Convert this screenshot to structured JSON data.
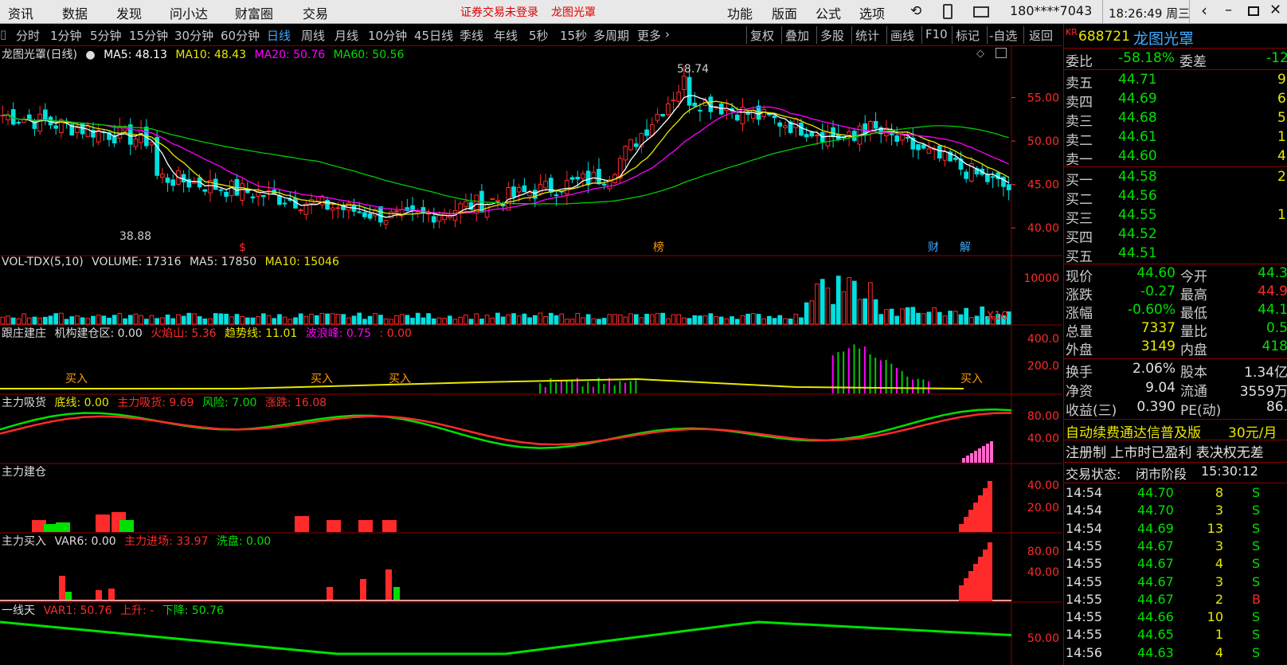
{
  "menubar": {
    "items": [
      "资讯",
      "数据",
      "发现",
      "问小达",
      "财富圈",
      "交易"
    ],
    "alert": "证券交易未登录",
    "stock_name": "龙图光罩",
    "right_items": [
      "功能",
      "版面",
      "公式",
      "选项"
    ],
    "account": "180****7043",
    "clock": "18:26:49 周三"
  },
  "periods": [
    "分时",
    "1分钟",
    "5分钟",
    "15分钟",
    "30分钟",
    "60分钟",
    "日线",
    "周线",
    "月线",
    "10分钟",
    "45日线",
    "季线",
    "年线",
    "5秒",
    "15秒",
    "多周期",
    "更多"
  ],
  "active_period": "日线",
  "tools": [
    "复权",
    "叠加",
    "多股",
    "统计",
    "画线",
    "F10",
    "标记",
    "-自选",
    "返回"
  ],
  "kline": {
    "title": "龙图光罩(日线)",
    "ma5": "MA5: 48.13",
    "ma10": "MA10: 48.43",
    "ma20": "MA20: 50.76",
    "ma60": "MA60: 50.56",
    "high_label": "58.74",
    "low_label": "38.88",
    "axis": [
      "55.00",
      "50.00",
      "45.00",
      "40.00"
    ],
    "markers": [
      "$",
      "榜",
      "财",
      "解"
    ]
  },
  "volume": {
    "title": "VOL-TDX(5,10)",
    "volume": "VOLUME: 17316",
    "ma5": "MA5: 17850",
    "ma10": "MA10: 15046",
    "axis": [
      "10000"
    ],
    "unit": "X10"
  },
  "ind1": {
    "title": "跟庄建庄",
    "l1": "机构建仓区: 0.00",
    "l2": "火焰山: 5.36",
    "l3": "趋势线: 11.01",
    "l4": "波浪峰: 0.75",
    "l5": ": 0.00",
    "axis": [
      "400.0",
      "200.0"
    ],
    "buy_label": "买入"
  },
  "ind2": {
    "title": "主力吸货",
    "l1": "底线: 0.00",
    "l2": "主力吸货: 9.69",
    "l3": "风险: 7.00",
    "l4": "涨跌: 16.08",
    "axis": [
      "80.00",
      "40.00"
    ]
  },
  "ind3": {
    "title": "主力建仓",
    "axis": [
      "40.00",
      "20.00"
    ]
  },
  "ind4": {
    "title": "主力买入",
    "l1": "VAR6: 0.00",
    "l2": "主力进场: 33.97",
    "l3": "洗盘: 0.00",
    "axis": [
      "80.00",
      "40.00"
    ]
  },
  "ind5": {
    "title": "一线天",
    "l1": "VAR1: 50.76",
    "l2": "上升: -",
    "l3": "下降: 50.76",
    "axis": [
      "50.00"
    ]
  },
  "quote": {
    "market_tag": "KR",
    "code": "688721",
    "name": "龙图光罩",
    "weibi_label": "委比",
    "weibi": "-58.18%",
    "weicha_label": "委差",
    "weicha": "-12",
    "asks": [
      {
        "label": "卖五",
        "price": "44.71",
        "vol": "9"
      },
      {
        "label": "卖四",
        "price": "44.69",
        "vol": "6"
      },
      {
        "label": "卖三",
        "price": "44.68",
        "vol": "5"
      },
      {
        "label": "卖二",
        "price": "44.61",
        "vol": "1"
      },
      {
        "label": "卖一",
        "price": "44.60",
        "vol": "4"
      }
    ],
    "bids": [
      {
        "label": "买一",
        "price": "44.58",
        "vol": "2"
      },
      {
        "label": "买二",
        "price": "44.56",
        "vol": ""
      },
      {
        "label": "买三",
        "price": "44.55",
        "vol": "1"
      },
      {
        "label": "买四",
        "price": "44.52",
        "vol": ""
      },
      {
        "label": "买五",
        "price": "44.51",
        "vol": ""
      }
    ],
    "stats": [
      {
        "l1": "现价",
        "v1": "44.60",
        "l2": "今开",
        "v2": "44.3"
      },
      {
        "l1": "涨跌",
        "v1": "-0.27",
        "l2": "最高",
        "v2": "44.9"
      },
      {
        "l1": "涨幅",
        "v1": "-0.60%",
        "l2": "最低",
        "v2": "44.1"
      },
      {
        "l1": "总量",
        "v1": "7337",
        "l2": "量比",
        "v2": "0.5"
      },
      {
        "l1": "外盘",
        "v1": "3149",
        "l2": "内盘",
        "v2": "418"
      }
    ],
    "stats2": [
      {
        "l1": "换手",
        "v1": "2.06%",
        "l2": "股本",
        "v2": "1.34亿"
      },
      {
        "l1": "净资",
        "v1": "9.04",
        "l2": "流通",
        "v2": "3559万"
      },
      {
        "l1": "收益(三)",
        "v1": "0.390",
        "l2": "PE(动)",
        "v2": "86."
      }
    ],
    "ad1": "自动续费通达信普及版",
    "ad1_price": "30元/月",
    "ad2": "注册制 上市时已盈利 表决权无差",
    "status_label": "交易状态:",
    "status": "闭市阶段",
    "status_time": "15:30:12",
    "ticks": [
      {
        "t": "14:54",
        "p": "44.70",
        "v": "8",
        "s": "S"
      },
      {
        "t": "14:54",
        "p": "44.70",
        "v": "3",
        "s": "S"
      },
      {
        "t": "14:54",
        "p": "44.69",
        "v": "13",
        "s": "S"
      },
      {
        "t": "14:55",
        "p": "44.67",
        "v": "3",
        "s": "S"
      },
      {
        "t": "14:55",
        "p": "44.67",
        "v": "4",
        "s": "S"
      },
      {
        "t": "14:55",
        "p": "44.67",
        "v": "3",
        "s": "S"
      },
      {
        "t": "14:55",
        "p": "44.67",
        "v": "2",
        "s": "B"
      },
      {
        "t": "14:55",
        "p": "44.66",
        "v": "10",
        "s": "S"
      },
      {
        "t": "14:55",
        "p": "44.65",
        "v": "1",
        "s": "S"
      },
      {
        "t": "14:56",
        "p": "44.63",
        "v": "4",
        "s": "S"
      }
    ]
  },
  "colors": {
    "up": "#ff2a2a",
    "down": "#00e0e0",
    "ma5": "#ffffff",
    "ma10": "#e8e800",
    "ma20": "#ff00ff",
    "ma60": "#00cc00",
    "grid": "#8b0000",
    "active_tab": "#3fa9ff"
  }
}
